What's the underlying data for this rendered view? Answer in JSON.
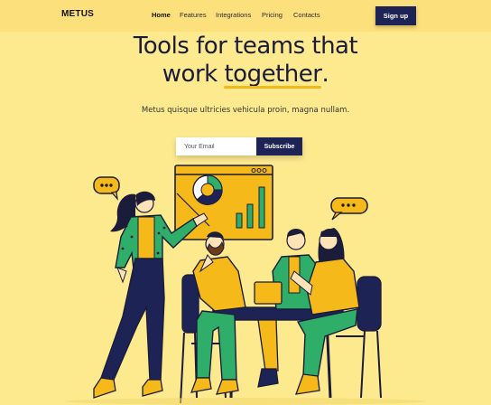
{
  "nav": {
    "logo": "METUS",
    "items": [
      "Home",
      "Features",
      "Integrations",
      "Pricing",
      "Contacts"
    ],
    "signup_label": "Sign up"
  },
  "hero": {
    "line1": "Tools for teams that",
    "line2_pre": "work ",
    "line2_highlight": "together",
    "line2_post": ".",
    "subtitle": "Metus quisque ultricies vehicula proin, magna nullam."
  },
  "form": {
    "email_placeholder": "Your Email",
    "subscribe_label": "Subscribe"
  },
  "colors": {
    "background": "#fdea8f",
    "navy": "#1d2354",
    "accent_yellow": "#f1b81c",
    "green": "#2fae6a"
  },
  "icons": [
    "speech-bubble-icon",
    "donut-chart-icon",
    "bar-chart-icon"
  ]
}
